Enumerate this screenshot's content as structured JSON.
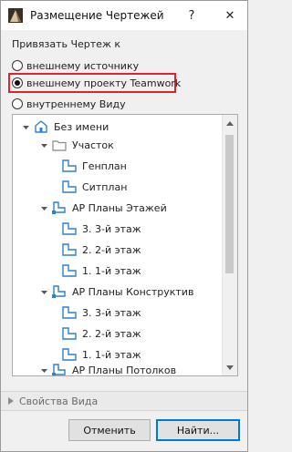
{
  "window": {
    "title": "Размещение Чертежей",
    "help_label": "?",
    "close_label": "✕"
  },
  "link_section": {
    "label": "Привязать Чертеж  к",
    "options": [
      {
        "label": "внешнему источнику",
        "selected": false
      },
      {
        "label": "внешнему проекту Teamwork",
        "selected": true
      },
      {
        "label": "внутреннему Виду",
        "selected": false
      }
    ]
  },
  "tree": {
    "items": [
      {
        "label": "Без имени",
        "level": 0,
        "icon": "project-map-icon",
        "expanded": true
      },
      {
        "label": "Участок",
        "level": 1,
        "icon": "folder-icon",
        "expanded": true
      },
      {
        "label": "Генплан",
        "level": 2,
        "icon": "floor-plan-view-icon"
      },
      {
        "label": "Ситплан",
        "level": 2,
        "icon": "floor-plan-view-icon"
      },
      {
        "label": "АР Планы Этажей",
        "level": 1,
        "icon": "plan-folder-icon",
        "expanded": true
      },
      {
        "label": "3. 3-й этаж",
        "level": 2,
        "icon": "floor-plan-view-icon"
      },
      {
        "label": "2. 2-й этаж",
        "level": 2,
        "icon": "floor-plan-view-icon"
      },
      {
        "label": "1. 1-й этаж",
        "level": 2,
        "icon": "floor-plan-view-icon"
      },
      {
        "label": "АР Планы Конструктив",
        "level": 1,
        "icon": "plan-folder-icon",
        "expanded": true
      },
      {
        "label": "3. 3-й этаж",
        "level": 2,
        "icon": "floor-plan-view-icon"
      },
      {
        "label": "2. 2-й этаж",
        "level": 2,
        "icon": "floor-plan-view-icon"
      },
      {
        "label": "1. 1-й этаж",
        "level": 2,
        "icon": "floor-plan-view-icon"
      },
      {
        "label": "АР Планы Потолков",
        "level": 1,
        "icon": "plan-folder-icon",
        "expanded": true
      }
    ]
  },
  "view_properties": {
    "label": "Свойства Вида"
  },
  "buttons": {
    "cancel": "Отменить",
    "find": "Найти..."
  },
  "colors": {
    "highlight_border": "#e0232b",
    "icon_blue": "#2f7fd1",
    "default_button_border": "#0078d7"
  }
}
